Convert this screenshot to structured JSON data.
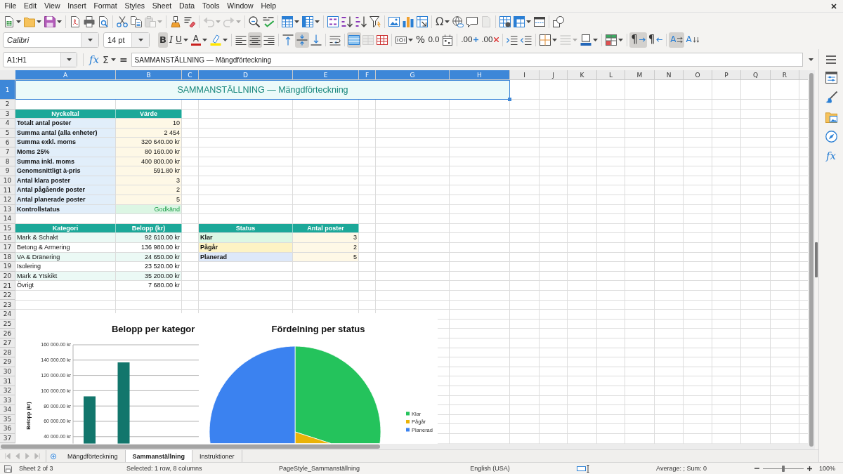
{
  "menu": [
    "File",
    "Edit",
    "View",
    "Insert",
    "Format",
    "Styles",
    "Sheet",
    "Data",
    "Tools",
    "Window",
    "Help"
  ],
  "standard_toolbar": [
    [
      {
        "kind": "new",
        "disabled": false
      },
      {
        "kind": "open",
        "disabled": false
      },
      {
        "kind": "save",
        "disabled": false
      }
    ],
    [
      {
        "kind": "export-pdf",
        "disabled": false
      },
      {
        "kind": "print",
        "disabled": false
      },
      {
        "kind": "print-preview",
        "disabled": false
      }
    ],
    [
      {
        "kind": "cut",
        "disabled": false
      },
      {
        "kind": "copy",
        "disabled": false
      },
      {
        "kind": "paste",
        "disabled": true
      }
    ],
    [
      {
        "kind": "clone-formatting",
        "disabled": false
      },
      {
        "kind": "clear-formatting",
        "disabled": false
      }
    ],
    [
      {
        "kind": "undo",
        "disabled": true
      },
      {
        "kind": "redo",
        "disabled": true
      }
    ],
    [
      {
        "kind": "find-replace",
        "disabled": false
      },
      {
        "kind": "spelling",
        "disabled": false
      }
    ],
    [
      {
        "kind": "rows",
        "disabled": false
      },
      {
        "kind": "columns",
        "disabled": false
      }
    ],
    [
      {
        "kind": "sort",
        "disabled": false
      },
      {
        "kind": "sort-ascending",
        "disabled": false
      },
      {
        "kind": "sort-descending",
        "disabled": false
      },
      {
        "kind": "autofilter",
        "disabled": false
      }
    ],
    [
      {
        "kind": "image",
        "disabled": false
      },
      {
        "kind": "chart",
        "disabled": false
      },
      {
        "kind": "pivot-table",
        "disabled": false
      }
    ],
    [
      {
        "kind": "special-character",
        "label": "Ω",
        "disabled": false
      },
      {
        "kind": "hyperlink",
        "disabled": false
      },
      {
        "kind": "comment",
        "disabled": false
      },
      {
        "kind": "header-footer",
        "disabled": true
      }
    ],
    [
      {
        "kind": "print-area",
        "disabled": false
      },
      {
        "kind": "freeze",
        "disabled": false
      },
      {
        "kind": "split-window",
        "disabled": false
      }
    ],
    [
      {
        "kind": "draw-functions",
        "disabled": false
      }
    ]
  ],
  "format_toolbar": {
    "font_name": "Calibri",
    "font_size": "14 pt",
    "groups": [
      [
        {
          "kind": "bold",
          "label": "B",
          "on": true,
          "disabled": false
        },
        {
          "kind": "italic",
          "label": "I",
          "on": false,
          "disabled": false
        },
        {
          "kind": "underline",
          "label": "U",
          "on": false,
          "disabled": false
        },
        {
          "kind": "font-color",
          "label": "A",
          "on": false,
          "disabled": false
        },
        {
          "kind": "highlight",
          "on": false,
          "disabled": false
        }
      ],
      [
        {
          "kind": "align-left",
          "on": false,
          "disabled": false
        },
        {
          "kind": "align-center",
          "on": true,
          "disabled": false
        },
        {
          "kind": "align-right",
          "on": false,
          "disabled": false
        }
      ],
      [
        {
          "kind": "align-top",
          "on": false,
          "disabled": false
        },
        {
          "kind": "align-middle",
          "on": true,
          "disabled": false
        },
        {
          "kind": "align-bottom",
          "on": false,
          "disabled": false
        }
      ],
      [
        {
          "kind": "wrap",
          "on": false,
          "disabled": false
        }
      ],
      [
        {
          "kind": "merge-center",
          "on": true,
          "disabled": false
        },
        {
          "kind": "merge",
          "on": false,
          "disabled": true
        },
        {
          "kind": "unmerge",
          "on": false,
          "disabled": false
        }
      ],
      [
        {
          "kind": "currency",
          "on": false,
          "disabled": false
        },
        {
          "kind": "percent",
          "label": "%",
          "on": false,
          "disabled": false
        },
        {
          "kind": "number",
          "label": "0.0",
          "on": false,
          "disabled": false
        },
        {
          "kind": "date",
          "on": false,
          "disabled": false
        }
      ],
      [
        {
          "kind": "add-decimal",
          "label": ".00",
          "on": false,
          "disabled": false
        },
        {
          "kind": "delete-decimal",
          "label": ".00",
          "on": false,
          "disabled": false
        }
      ],
      [
        {
          "kind": "indent",
          "on": false,
          "disabled": false
        },
        {
          "kind": "outdent",
          "on": false,
          "disabled": false
        }
      ],
      [
        {
          "kind": "borders",
          "on": false,
          "disabled": false
        },
        {
          "kind": "border-style",
          "on": false,
          "disabled": true
        },
        {
          "kind": "border-color",
          "on": false,
          "disabled": false
        }
      ],
      [
        {
          "kind": "conditional",
          "on": false,
          "disabled": false
        }
      ],
      [
        {
          "kind": "paragraph-ltr",
          "label": "¶",
          "on": true,
          "disabled": false
        },
        {
          "kind": "paragraph-rtl",
          "label": "¶",
          "on": false,
          "disabled": false
        }
      ],
      [
        {
          "kind": "text-ltr",
          "label": "A",
          "on": true,
          "disabled": false
        },
        {
          "kind": "text-ttb",
          "label": "A",
          "on": false,
          "disabled": false
        }
      ]
    ]
  },
  "formula_bar": {
    "name_box": "A1:H1",
    "wizard_label": "fx",
    "sum_label": "Σ",
    "equals_label": "=",
    "formula": "SAMMANSTÄLLNING — Mängdförteckning"
  },
  "sidebar": {
    "functions_label": "fx"
  },
  "sheet": {
    "columns": [
      {
        "label": "A",
        "selected": true
      },
      {
        "label": "B",
        "selected": true
      },
      {
        "label": "C",
        "selected": true
      },
      {
        "label": "D",
        "selected": true
      },
      {
        "label": "E",
        "selected": true
      },
      {
        "label": "F",
        "selected": true
      },
      {
        "label": "G",
        "selected": true
      },
      {
        "label": "H",
        "selected": true
      },
      {
        "label": "I",
        "selected": false
      },
      {
        "label": "J",
        "selected": false
      },
      {
        "label": "K",
        "selected": false
      },
      {
        "label": "L",
        "selected": false
      },
      {
        "label": "M",
        "selected": false
      },
      {
        "label": "N",
        "selected": false
      },
      {
        "label": "O",
        "selected": false
      },
      {
        "label": "P",
        "selected": false
      },
      {
        "label": "Q",
        "selected": false
      },
      {
        "label": "R",
        "selected": false
      }
    ],
    "rows": [
      {
        "label": "1",
        "selected": true
      },
      {
        "label": "2",
        "selected": false
      },
      {
        "label": "3",
        "selected": false
      },
      {
        "label": "4",
        "selected": false
      },
      {
        "label": "5",
        "selected": false
      },
      {
        "label": "6",
        "selected": false
      },
      {
        "label": "7",
        "selected": false
      },
      {
        "label": "8",
        "selected": false
      },
      {
        "label": "9",
        "selected": false
      },
      {
        "label": "10",
        "selected": false
      },
      {
        "label": "11",
        "selected": false
      },
      {
        "label": "12",
        "selected": false
      },
      {
        "label": "13",
        "selected": false
      },
      {
        "label": "14",
        "selected": false
      },
      {
        "label": "15",
        "selected": false
      },
      {
        "label": "16",
        "selected": false
      },
      {
        "label": "17",
        "selected": false
      },
      {
        "label": "18",
        "selected": false
      },
      {
        "label": "19",
        "selected": false
      },
      {
        "label": "20",
        "selected": false
      },
      {
        "label": "21",
        "selected": false
      },
      {
        "label": "22",
        "selected": false
      },
      {
        "label": "23",
        "selected": false
      },
      {
        "label": "24",
        "selected": false
      },
      {
        "label": "25",
        "selected": false
      },
      {
        "label": "26",
        "selected": false
      },
      {
        "label": "27",
        "selected": false
      },
      {
        "label": "28",
        "selected": false
      },
      {
        "label": "29",
        "selected": false
      },
      {
        "label": "30",
        "selected": false
      },
      {
        "label": "31",
        "selected": false
      },
      {
        "label": "32",
        "selected": false
      },
      {
        "label": "33",
        "selected": false
      },
      {
        "label": "34",
        "selected": false
      },
      {
        "label": "35",
        "selected": false
      },
      {
        "label": "36",
        "selected": false
      },
      {
        "label": "37",
        "selected": false
      }
    ],
    "title": "SAMMANSTÄLLNING — Mängdförteckning",
    "key_figures": {
      "headers": [
        "Nyckeltal",
        "Värde"
      ],
      "rows": [
        {
          "label": "Totalt antal poster",
          "value": "10",
          "kind": "number"
        },
        {
          "label": "Summa antal (alla enheter)",
          "value": "2 454",
          "kind": "number"
        },
        {
          "label": "Summa exkl. moms",
          "value": "320 640.00 kr",
          "kind": "number"
        },
        {
          "label": "Moms 25%",
          "value": "80 160.00 kr",
          "kind": "number"
        },
        {
          "label": "Summa inkl. moms",
          "value": "400 800.00 kr",
          "kind": "number"
        },
        {
          "label": "Genomsnittligt à-pris",
          "value": "591.80 kr",
          "kind": "number"
        },
        {
          "label": "Antal klara poster",
          "value": "3",
          "kind": "number"
        },
        {
          "label": "Antal pågående poster",
          "value": "2",
          "kind": "number"
        },
        {
          "label": "Antal planerade poster",
          "value": "5",
          "kind": "number"
        },
        {
          "label": "Kontrollstatus",
          "value": "Godkänd",
          "kind": "status"
        }
      ]
    },
    "categories": {
      "headers": [
        "Kategori",
        "Belopp (kr)"
      ],
      "rows": [
        {
          "label": "Mark & Schakt",
          "value": "92 610.00 kr"
        },
        {
          "label": "Betong & Armering",
          "value": "136 980.00 kr"
        },
        {
          "label": "VA & Dränering",
          "value": "24 650.00 kr"
        },
        {
          "label": "Isolering",
          "value": "23 520.00 kr"
        },
        {
          "label": "Mark & Ytskikt",
          "value": "35 200.00 kr"
        },
        {
          "label": "Övrigt",
          "value": "7 680.00 kr"
        }
      ]
    },
    "status_counts": {
      "headers": [
        "Status",
        "Antal poster"
      ],
      "rows": [
        {
          "label": "Klar",
          "value": "3",
          "color": "#dcf7e4"
        },
        {
          "label": "Pågår",
          "value": "2",
          "color": "#fdf3c4"
        },
        {
          "label": "Planerad",
          "value": "5",
          "color": "#dde8f9"
        }
      ]
    },
    "bar_chart": {
      "chart_data": {
        "type": "bar",
        "title": "Belopp per kategor",
        "ylabel": "Belopp (kr)",
        "series": [
          {
            "color": "#12766c",
            "values": [
              92610,
              136980
            ]
          }
        ],
        "ylim": [
          31000,
          160000
        ],
        "yticks": [
          {
            "value": 40000,
            "label": "40 000.00 kr"
          },
          {
            "value": 60000,
            "label": "60 000.00 kr"
          },
          {
            "value": 80000,
            "label": "80 000.00 kr"
          },
          {
            "value": 100000,
            "label": "100 000.00 kr"
          },
          {
            "value": 120000,
            "label": "120 000.00 kr"
          },
          {
            "value": 140000,
            "label": "140 000.00 kr"
          },
          {
            "value": 160000,
            "label": "160 000.00 kr"
          }
        ],
        "grid": true
      }
    },
    "pie_chart": {
      "title": "Fördelning per status",
      "legend": [
        {
          "label": "Klar",
          "color": "#24c35c"
        },
        {
          "label": "Pågår",
          "color": "#eab308"
        },
        {
          "label": "Planerad",
          "color": "#3b82f0"
        }
      ]
    }
  },
  "sheet_tabs": {
    "navigation_disabled": true,
    "tabs": [
      {
        "label": "Mängdförteckning",
        "selected": false
      },
      {
        "label": "Sammanställning",
        "selected": true
      },
      {
        "label": "Instruktioner",
        "selected": false
      }
    ]
  },
  "status_bar": {
    "sheet_info": "Sheet 2 of 3",
    "selection": "Selected: 1 row, 8 columns",
    "page_style": "PageStyle_Sammanställning",
    "language": "English (USA)",
    "summary": "Average: ; Sum: 0",
    "zoom": {
      "level": 0.5,
      "reading": "100%"
    }
  }
}
